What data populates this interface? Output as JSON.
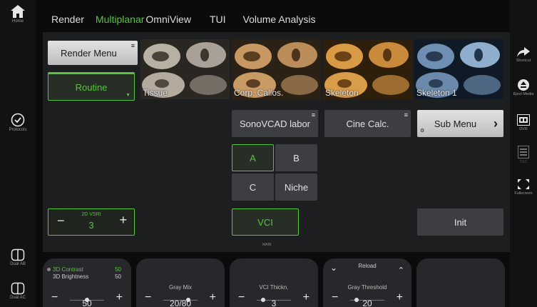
{
  "left_rail": {
    "home_label": "Home",
    "protocols_label": "Protocols",
    "dual_ab_label": "Dual AB",
    "dual_ac_label": "Dual AC"
  },
  "tabs": [
    {
      "label": "Render",
      "active": false
    },
    {
      "label": "Multiplanar",
      "active": true
    },
    {
      "label": "OmniView",
      "active": false
    },
    {
      "label": "TUI",
      "active": false
    },
    {
      "label": "Volume Analysis",
      "active": false
    }
  ],
  "panel": {
    "render_menu_label": "Render Menu",
    "routine_label": "Routine",
    "thumbnails": [
      {
        "label": "Tissue"
      },
      {
        "label": "Corp. Callos."
      },
      {
        "label": "Skeleton"
      },
      {
        "label": "Skeleton 1"
      }
    ],
    "sonovcad_label": "SonoVCAD labor",
    "cine_calc_label": "Cine Calc.",
    "sub_menu_label": "Sub Menu",
    "plane_a": "A",
    "plane_b": "B",
    "plane_c": "C",
    "plane_niche": "Niche",
    "vsri_name": "2D VSRI",
    "vsri_value": "3",
    "vci_label": "VCI",
    "main_label": "MAIN",
    "init_label": "Init"
  },
  "right_rail": {
    "shortcut_label": "Shortcut",
    "eject_label": "Eject Media",
    "dvr_label": "DVR",
    "tgc_label": "TGC",
    "fullscreen_label": "Fullscreen"
  },
  "bottom": {
    "contrast_label": "3D Contrast",
    "contrast_value": "50",
    "brightness_label": "3D Brightness",
    "brightness_value": "50",
    "knob1_value": "50",
    "gray_mix_label": "Gray Mix",
    "gray_mix_value": "20/80",
    "vci_thick_label": "VCI Thickn.",
    "vci_thick_value": "3",
    "reload_label": "Reload",
    "gray_thresh_label": "Gray Threshold",
    "gray_thresh_value": "20"
  },
  "colors": {
    "accent": "#57c53c",
    "panel": "#1d1e20",
    "background": "#0b0b0c"
  }
}
